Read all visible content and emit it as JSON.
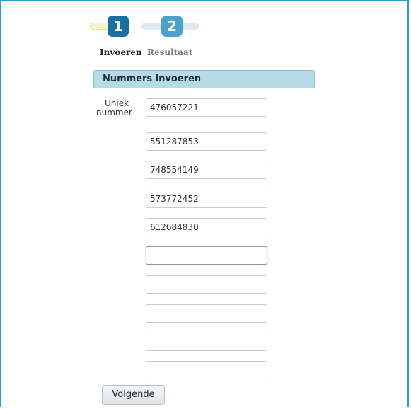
{
  "wizard": {
    "steps": [
      {
        "number": "1",
        "label": "Invoeren",
        "state": "active"
      },
      {
        "number": "2",
        "label": "Resultaat",
        "state": "inactive"
      }
    ]
  },
  "section": {
    "title": "Nummers invoeren"
  },
  "form": {
    "label_line1": "Uniek",
    "label_line2": "nummer",
    "inputs": [
      {
        "value": "476057221"
      },
      {
        "value": "551287853"
      },
      {
        "value": "748554149"
      },
      {
        "value": "573772452"
      },
      {
        "value": "612684830"
      },
      {
        "value": "",
        "focused": true
      },
      {
        "value": ""
      },
      {
        "value": ""
      },
      {
        "value": ""
      },
      {
        "value": ""
      }
    ],
    "next_label": "Volgende"
  },
  "colors": {
    "frame_border": "#2e9bd4",
    "step_active": "#1a6fa3",
    "step_inactive": "#4ba2cd",
    "header_bg": "#b5dbe8"
  }
}
